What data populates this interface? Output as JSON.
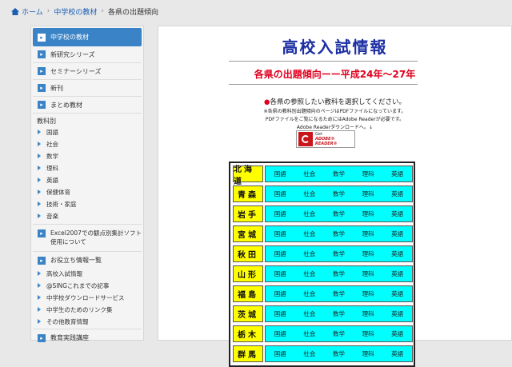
{
  "breadcrumb": {
    "home": "ホーム",
    "parent": "中学校の教材",
    "current": "各県の出題傾向"
  },
  "sidebar": {
    "active": "中学校の教材",
    "items": [
      "新研究シリーズ",
      "セミナーシリーズ",
      "新刊",
      "まとめ教材"
    ],
    "subject_heading": "教科別",
    "subjects": [
      "国語",
      "社会",
      "数学",
      "理科",
      "英語",
      "保健体育",
      "技術・家庭",
      "音楽"
    ],
    "excel_line1": "Excel2007での観点別集計ソフト",
    "excel_line2": "使用について",
    "useful": "お役立ち情報一覧",
    "useful_sub": [
      "高校入試情報",
      "@SINGこれまでの記事",
      "中学校ダウンロードサービス",
      "中学生のためのリンク集",
      "その他教育情報"
    ],
    "last": "教育実践講座"
  },
  "main": {
    "title": "高校入試情報",
    "subtitle": "各県の出題傾向ーー平成24年〜27年",
    "instruction": "各県の参照したい教科を選択してください。",
    "note1": "※各県の教科別出題傾向のページはPDFファイルになっています。",
    "note2": "PDFファイルをご覧になるためにはAdobe Readerが必要です。",
    "note3": "Adobe Readerダウンロードへ。↓",
    "reader_get": "Get",
    "reader_name": "ADOBE® READER®"
  },
  "colors": {
    "accent": "#3a83c6",
    "title": "#1c2fa3",
    "subtitle": "#e0001e",
    "pref_bg": "#ffff00",
    "subject_bg": "#00ffff"
  },
  "table": {
    "subjects": [
      "国語",
      "社会",
      "数学",
      "理科",
      "英語"
    ],
    "prefectures": [
      "北海道",
      "青森",
      "岩手",
      "宮城",
      "秋田",
      "山形",
      "福島",
      "茨城",
      "栃木",
      "群馬"
    ]
  }
}
